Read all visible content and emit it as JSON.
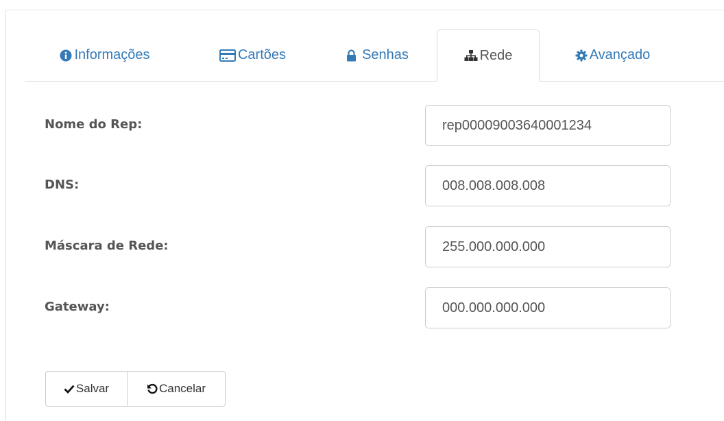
{
  "tabs": [
    {
      "label": "Informações",
      "icon": "info-circle-icon",
      "active": false
    },
    {
      "label": "Cartões",
      "icon": "credit-card-icon",
      "active": false
    },
    {
      "label": "Senhas",
      "icon": "lock-icon",
      "active": false
    },
    {
      "label": "Rede",
      "icon": "sitemap-icon",
      "active": true
    },
    {
      "label": "Avançado",
      "icon": "gear-icon",
      "active": false
    }
  ],
  "form": {
    "rep_name": {
      "label": "Nome do Rep:",
      "value": "rep00009003640001234"
    },
    "dns": {
      "label": "DNS:",
      "value": "008.008.008.008"
    },
    "netmask": {
      "label": "Máscara de Rede:",
      "value": "255.000.000.000"
    },
    "gateway": {
      "label": "Gateway:",
      "value": "000.000.000.000"
    }
  },
  "actions": {
    "save_label": "Salvar",
    "cancel_label": "Cancelar"
  },
  "colors": {
    "link": "#337ab7",
    "text": "#555555",
    "border": "#dddddd"
  }
}
